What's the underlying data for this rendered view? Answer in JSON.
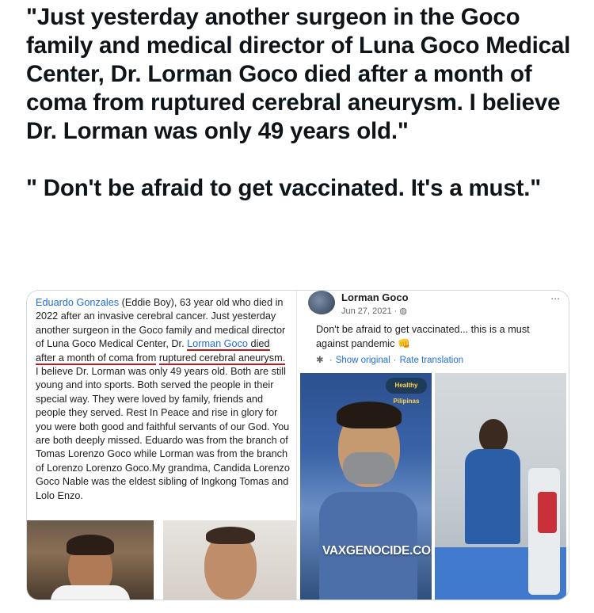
{
  "tweet": {
    "paragraph1": "\"Just yesterday another surgeon in the Goco family and medical director of Luna Goco Medical Center, Dr. Lorman Goco died after a month of coma from ruptured cerebral aneurysm. I believe Dr. Lorman was only 49 years old.\"",
    "paragraph2": "\" Don't be afraid to get vaccinated. It's a must.\""
  },
  "left_post": {
    "author_link": "Eduardo Gonzales",
    "text_a": " (Eddie Boy), 63 year old who died in 2022 after an invasive cerebral cancer. Just yesterday another surgeon in the Goco family and medical director of Luna Goco Medical Center, Dr. ",
    "lorman_link": "Lorman Goco",
    "underlined_a": " died after a month of coma from",
    "underlined_b": "ruptured cerebral aneurysm.",
    "text_b": " I believe Dr. Lorman was only 49 years old. Both are still young and into sports. Both served the people in their special way. They were loved by family, friends and people they served. Rest In Peace and rise in glory for you were both  good and faithful servants of our God. You are both deeply missed. Eduardo was from the branch of Tomas Lorenzo Goco while Lorman was from the branch of Lorenzo Lorenzo Goco.My grandma, Candida Lorenzo Goco Nable was the eldest sibling of Ingkong Tomas and Lolo Enzo."
  },
  "right_post": {
    "author": "Lorman Goco",
    "date": "Jun 27, 2021 · ",
    "globe_icon": "globe-icon",
    "more": "...",
    "body": "Don't be afraid to get vaccinated... this is a must against pandemic ",
    "emoji": "👊",
    "show_original": "Show original",
    "separator": "·",
    "rate_translation": "Rate translation",
    "watermark": "VAXGENOCIDE.COM",
    "badge": "Healthy Pilipinas"
  },
  "colors": {
    "link": "#216fdb",
    "underline": "#c0181f",
    "card_border": "#cfd9de"
  }
}
